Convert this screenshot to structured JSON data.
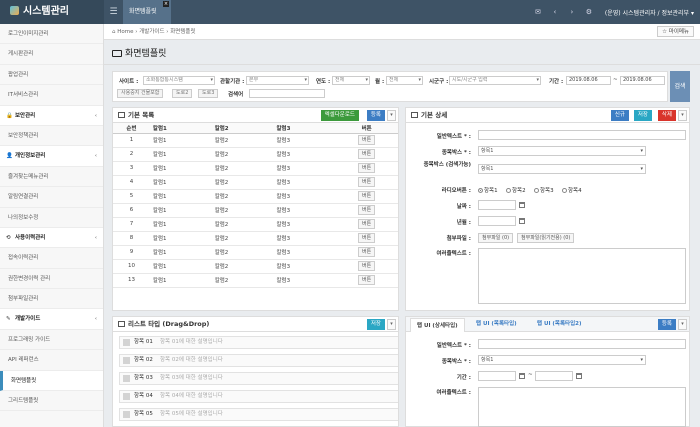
{
  "app": {
    "title": "시스템관리",
    "tab": "화면템플릿"
  },
  "topbar": {
    "user": "(운영) 시스템관리자 / 정보관리부 ▾"
  },
  "sidebar": {
    "items": [
      {
        "label": "로그인이미지관리",
        "type": "item"
      },
      {
        "label": "게시판관리",
        "type": "item"
      },
      {
        "label": "팝업관리",
        "type": "item"
      },
      {
        "label": "IT서비스관리",
        "type": "item"
      },
      {
        "label": "보안관리",
        "type": "sec",
        "icon": "lock-icon"
      },
      {
        "label": "보안정책관리",
        "type": "item"
      },
      {
        "label": "개인정보관리",
        "type": "sec",
        "icon": "user-icon"
      },
      {
        "label": "즐겨찾는메뉴관리",
        "type": "item"
      },
      {
        "label": "알림연결관리",
        "type": "item"
      },
      {
        "label": "나의정보수정",
        "type": "item"
      },
      {
        "label": "사용이력관리",
        "type": "sec",
        "icon": "history-icon"
      },
      {
        "label": "접속이력관리",
        "type": "item"
      },
      {
        "label": "권한변경이력 관리",
        "type": "item"
      },
      {
        "label": "첨부파일관리",
        "type": "item"
      },
      {
        "label": "개발가이드",
        "type": "sec",
        "icon": "wrench-icon"
      },
      {
        "label": "프로그래밍 가이드",
        "type": "item"
      },
      {
        "label": "API 레퍼런스",
        "type": "item"
      },
      {
        "label": "화면템플릿",
        "type": "active"
      },
      {
        "label": "그리드템플릿",
        "type": "item"
      }
    ]
  },
  "breadcrumb": {
    "home": "Home",
    "sep": "›",
    "level1": "개발가이드",
    "level2": "화면템플릿",
    "favorite": "☆ 마이메뉴"
  },
  "page": {
    "title": "화면템플릿"
  },
  "search": {
    "site_label": "사이트",
    "site_value": "소화통합통시스템",
    "org_label": "관할기관",
    "org_value": "본부",
    "year_label": "연도",
    "year_value": "전체",
    "month_label": "월",
    "month_value": "전체",
    "city_label": "시군구",
    "city_placeholder": "시도/시군구 입력",
    "period_label": "기간",
    "date_from": "2019.08.06",
    "date_to": "2019.08.06",
    "tilde": "~",
    "chips": [
      "사용중지 건물포함",
      "도로2",
      "도로3"
    ],
    "keyword_label": "검색어",
    "button": "검색"
  },
  "list_panel": {
    "title": "기본 목록",
    "excel": "엑셀다운로드",
    "register": "등록",
    "headers": [
      "순번",
      "칼럼1",
      "칼럼2",
      "칼럼3",
      "버튼"
    ],
    "rows": [
      [
        "1",
        "칼럼1",
        "칼럼2",
        "칼럼3",
        "버튼"
      ],
      [
        "2",
        "칼럼1",
        "칼럼2",
        "칼럼3",
        "버튼"
      ],
      [
        "3",
        "칼럼1",
        "칼럼2",
        "칼럼3",
        "버튼"
      ],
      [
        "4",
        "칼럼1",
        "칼럼2",
        "칼럼3",
        "버튼"
      ],
      [
        "5",
        "칼럼1",
        "칼럼2",
        "칼럼3",
        "버튼"
      ],
      [
        "6",
        "칼럼1",
        "칼럼2",
        "칼럼3",
        "버튼"
      ],
      [
        "7",
        "칼럼1",
        "칼럼2",
        "칼럼3",
        "버튼"
      ],
      [
        "8",
        "칼럼1",
        "칼럼2",
        "칼럼3",
        "버튼"
      ],
      [
        "9",
        "칼럼1",
        "칼럼2",
        "칼럼3",
        "버튼"
      ],
      [
        "10",
        "칼럼1",
        "칼럼2",
        "칼럼3",
        "버튼"
      ],
      [
        "13",
        "칼럼1",
        "칼럼2",
        "칼럼3",
        "버튼"
      ]
    ]
  },
  "detail_panel": {
    "title": "기본 상세",
    "new": "신규",
    "save": "저장",
    "delete": "삭제",
    "text_label": "일반텍스트",
    "select_label": "종목박스",
    "select_value": "항목1",
    "multi_label": "종목박스 (검색가능)",
    "multi_value": "항목1",
    "radio_label": "라디오버튼",
    "radios": [
      "항목1",
      "항목2",
      "항목3",
      "항목4"
    ],
    "date_label": "날짜",
    "month_label": "년월",
    "file_label": "첨부파일",
    "file_btn1": "첨부파일 (0)",
    "file_btn2": "첨부파일(읽기전용) (0)",
    "textarea_label": "여러줄텍스트"
  },
  "drag_panel": {
    "title": "리스트 타입 (Drag&Drop)",
    "save": "저장",
    "items": [
      {
        "name": "항목 01",
        "desc": "항목 01에 대한 설명입니다",
        "edit": "수정"
      },
      {
        "name": "항목 02",
        "desc": "항목 02에 대한 설명입니다",
        "edit": "수정"
      },
      {
        "name": "항목 03",
        "desc": "항목 03에 대한 설명입니다",
        "edit": "수정"
      },
      {
        "name": "항목 04",
        "desc": "항목 04에 대한 설명입니다",
        "edit": "수정"
      },
      {
        "name": "항목 05",
        "desc": "항목 05에 대한 설명입니다",
        "edit": "수정"
      }
    ]
  },
  "tab_panel": {
    "tabs": [
      "탭 UI (상세타입)",
      "탭 UI (목록타입)",
      "탭 UI (목록타입2)"
    ],
    "register": "등록",
    "text_label": "일반텍스트",
    "select_label": "종목박스",
    "select_value": "항목1",
    "period_label": "기간",
    "tilde": "~",
    "textarea_label": "여러줄텍스트"
  },
  "colors": {
    "topbar": "#3e5366",
    "accent": "#3c8dbc",
    "green": "#3c9a3c",
    "blue": "#3c7dc4",
    "red": "#d9342b",
    "orange": "#e79c2b"
  }
}
